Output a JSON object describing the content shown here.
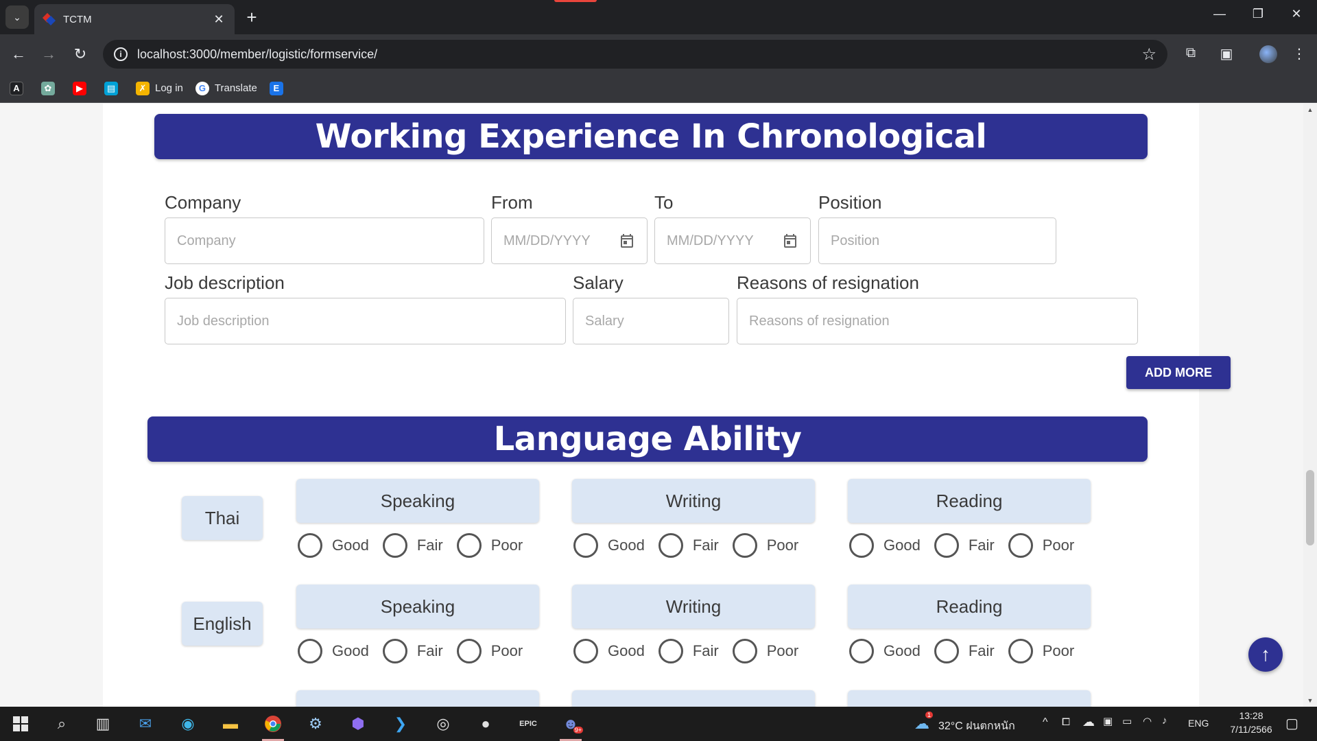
{
  "browser": {
    "tab_title": "TCTM",
    "url": "localhost:3000/member/logistic/formservice/",
    "bookmarks": [
      {
        "label": "",
        "icon": "A"
      },
      {
        "label": "",
        "icon": "chatgpt-icon"
      },
      {
        "label": "",
        "icon": "youtube-icon"
      },
      {
        "label": "",
        "icon": "bilibili-icon"
      },
      {
        "label": "Log in",
        "icon": "login-icon"
      },
      {
        "label": "Translate",
        "icon": "google-icon"
      },
      {
        "label": "",
        "icon": "E"
      }
    ]
  },
  "working_experience": {
    "title": "Working Experience In Chronological",
    "fields": {
      "company": {
        "label": "Company",
        "placeholder": "Company"
      },
      "from": {
        "label": "From",
        "placeholder": "MM/DD/YYYY"
      },
      "to": {
        "label": "To",
        "placeholder": "MM/DD/YYYY"
      },
      "position": {
        "label": "Position",
        "placeholder": "Position"
      },
      "job_description": {
        "label": "Job description",
        "placeholder": "Job description"
      },
      "salary": {
        "label": "Salary",
        "placeholder": "Salary"
      },
      "reasons": {
        "label": "Reasons of resignation",
        "placeholder": "Reasons of resignation"
      }
    },
    "add_more_label": "ADD MORE"
  },
  "language_ability": {
    "title": "Language Ability",
    "languages": [
      {
        "name": "Thai",
        "skills": [
          {
            "name": "Speaking"
          },
          {
            "name": "Writing"
          },
          {
            "name": "Reading"
          }
        ]
      },
      {
        "name": "English",
        "skills": [
          {
            "name": "Speaking"
          },
          {
            "name": "Writing"
          },
          {
            "name": "Reading"
          }
        ]
      }
    ],
    "levels": [
      "Good",
      "Fair",
      "Poor"
    ]
  },
  "taskbar": {
    "weather": "32°C  ฝนตกหนัก",
    "lang": "ENG",
    "time": "13:28",
    "date": "7/11/2566",
    "weather_badge": "1",
    "discord_badge": "9+"
  },
  "colors": {
    "primary": "#2e3192",
    "chip": "#dbe6f4"
  }
}
